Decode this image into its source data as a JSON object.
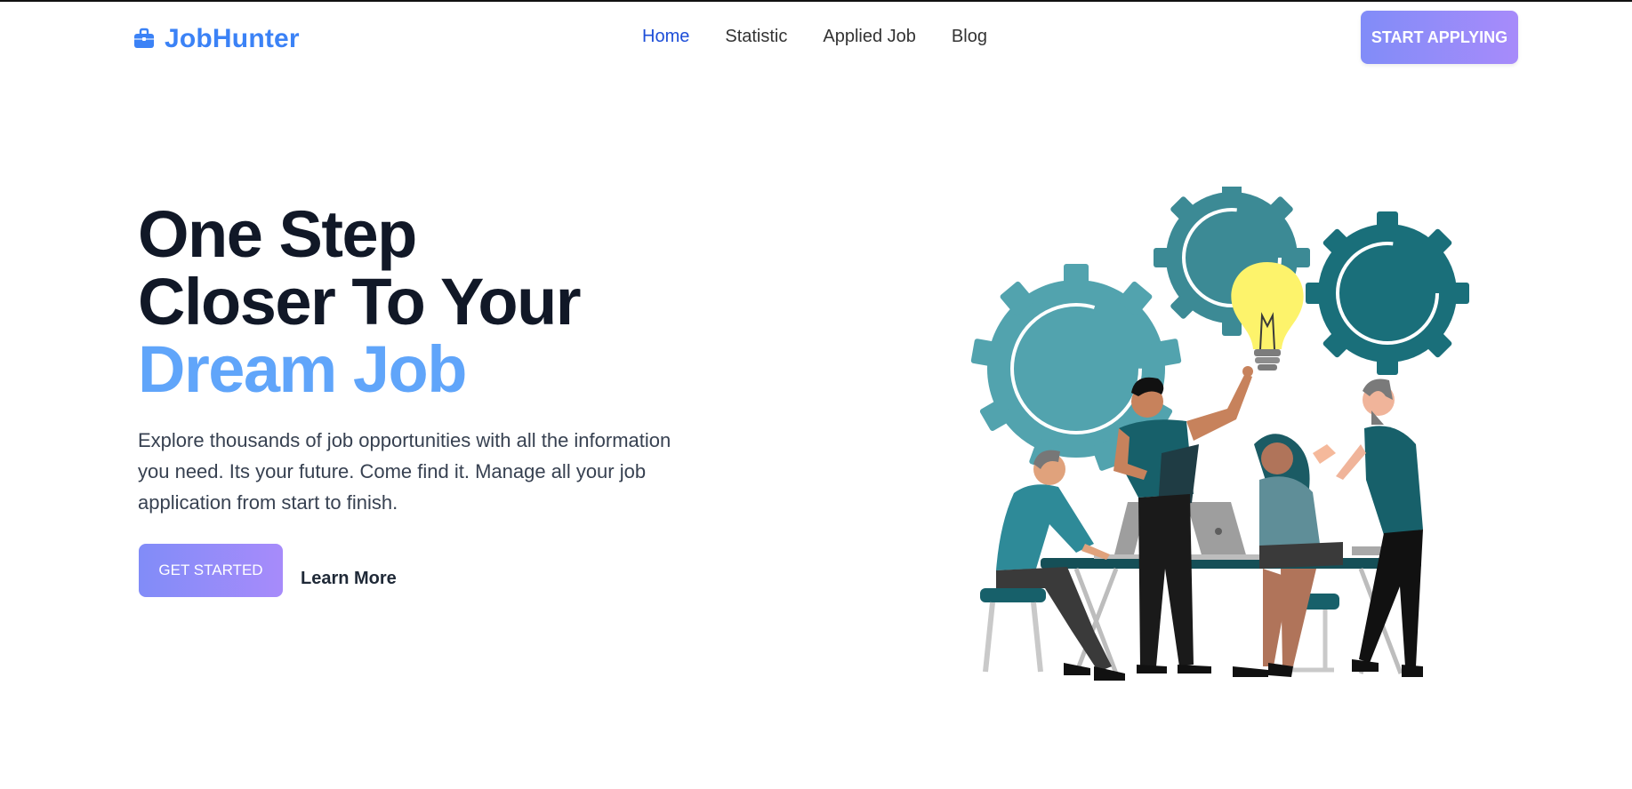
{
  "brand": {
    "name": "JobHunter",
    "color": "#3b82f6",
    "icon": "briefcase-icon"
  },
  "nav": {
    "items": [
      {
        "label": "Home",
        "active": true
      },
      {
        "label": "Statistic",
        "active": false
      },
      {
        "label": "Applied Job",
        "active": false
      },
      {
        "label": "Blog",
        "active": false
      }
    ],
    "cta_label": "START APPLYING"
  },
  "hero": {
    "title_line1": "One Step",
    "title_line2": "Closer To Your",
    "title_accent": "Dream Job",
    "description": "Explore thousands of job opportunities with all the information you need. Its your future. Come find it. Manage all your job application from start to finish.",
    "primary_button": "GET STARTED",
    "secondary_link": "Learn More"
  },
  "colors": {
    "accent_blue": "#60a5fa",
    "button_gradient_start": "#818cf8",
    "button_gradient_end": "#a78bfa",
    "heading": "#111827",
    "teal_dark": "#1a6f7a",
    "teal_mid": "#3c8a95",
    "teal_light": "#52a3ae",
    "bulb": "#fdf36b"
  },
  "illustration": {
    "name": "team-brainstorm-illustration"
  }
}
